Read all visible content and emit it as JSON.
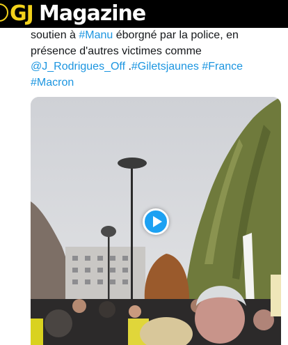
{
  "header": {
    "logo_gj": "GJ",
    "logo_magazine": "Magazine"
  },
  "tweet": {
    "line1_prefix": "soutien à ",
    "line1_tag": "#Manu",
    "line1_suffix": " éborgné par la police, en",
    "line2": "présence d'autres victimes comme",
    "line3_mention": "@J_Rodrigues_Off",
    "line3_mid": " .",
    "line3_tag1": "#Giletsjaunes",
    "line3_space": " ",
    "line3_tag2": "#France",
    "line4_tag": "#Macron"
  },
  "video": {
    "play_icon": "play-icon"
  },
  "colors": {
    "link": "#1b95e0",
    "header_bg": "#000000",
    "logo_yellow": "#f2d21b",
    "play_button": "#1da1f2"
  }
}
